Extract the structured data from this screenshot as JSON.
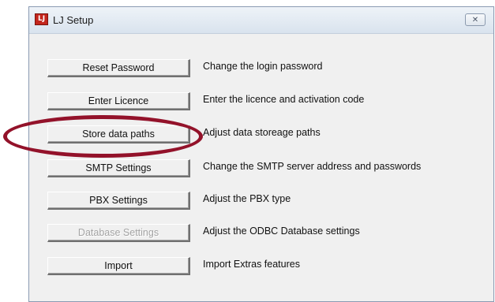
{
  "window": {
    "title": "LJ Setup",
    "close_glyph": "✕",
    "app_icon": "lj-app-icon",
    "app_icon_text": "LJ"
  },
  "rows": [
    {
      "button": "Reset Password",
      "description": "Change the login password",
      "enabled": true
    },
    {
      "button": "Enter Licence",
      "description": "Enter the licence and activation code",
      "enabled": true
    },
    {
      "button": "Store data paths",
      "description": "Adjust data storeage paths",
      "enabled": true
    },
    {
      "button": "SMTP Settings",
      "description": "Change the SMTP server address and passwords",
      "enabled": true
    },
    {
      "button": "PBX Settings",
      "description": "Adjust the PBX type",
      "enabled": true
    },
    {
      "button": "Database Settings",
      "description": "Adjust the ODBC Database settings",
      "enabled": false
    },
    {
      "button": "Import",
      "description": "Import Extras features",
      "enabled": true
    }
  ],
  "annotation": {
    "highlight_color": "#93122a",
    "highlighted_item": "Store data paths"
  },
  "colors": {
    "app_icon": "#c3261d",
    "dialog_bg": "#f0f0f0",
    "disabled_text": "#a4a4a4"
  }
}
